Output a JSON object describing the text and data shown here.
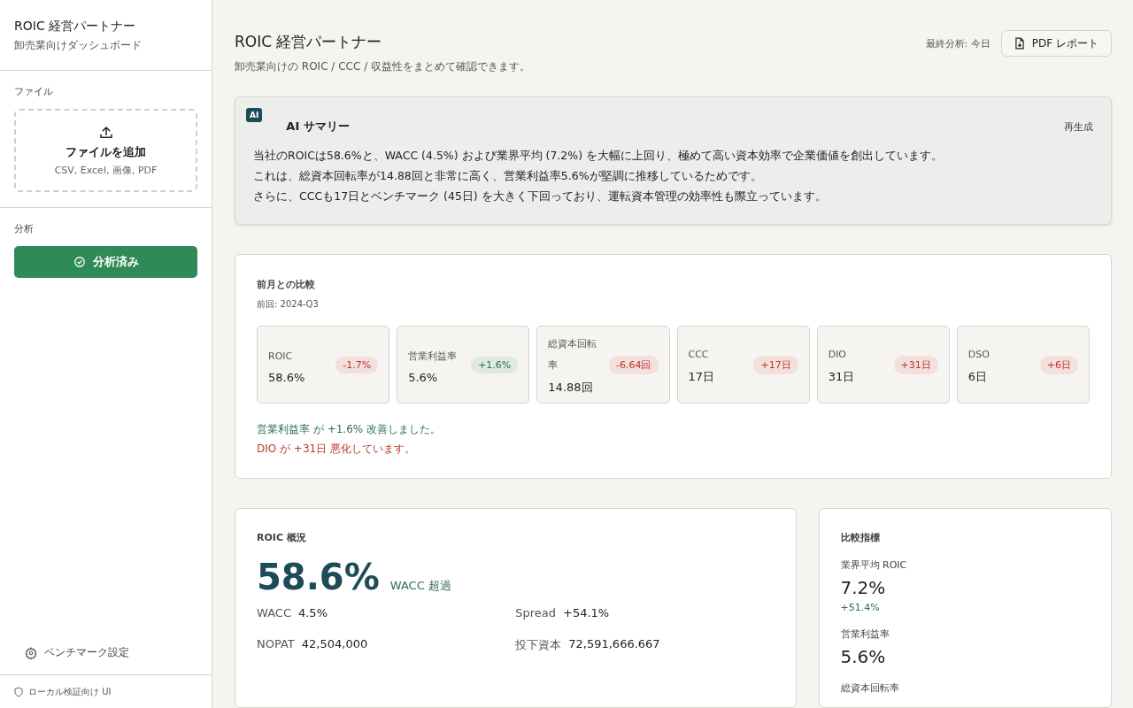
{
  "sidebar": {
    "app_title": "ROIC 経営パートナー",
    "app_subtitle": "卸売業向けダッシュボード",
    "file_section": {
      "heading": "ファイル",
      "upload_label": "ファイルを追加",
      "upload_hint": "CSV, Excel, 画像, PDF"
    },
    "analysis_section": {
      "heading": "分析",
      "button_label": "分析済み",
      "done": true
    },
    "settings_link": "ベンチマーク設定",
    "footer_note": "ローカル検証向け UI"
  },
  "header": {
    "title": "ROIC 経営パートナー",
    "subtitle": "卸売業向けの ROIC / CCC / 収益性をまとめて確認できます。",
    "last_analysis": "最終分析: 今日",
    "pdf_button": "PDF レポート"
  },
  "ai_summary": {
    "badge": "AI",
    "title": "AI サマリー",
    "regenerate": "再生成",
    "lines": [
      "当社のROICは58.6%と、WACC (4.5%) および業界平均 (7.2%) を大幅に上回り、極めて高い資本効率で企業価値を創出しています。",
      "これは、総資本回転率が14.88回と非常に高く、営業利益率5.6%が堅調に推移しているためです。",
      "さらに、CCCも17日とベンチマーク (45日) を大きく下回っており、運転資本管理の効率性も際立っています。"
    ]
  },
  "comparison": {
    "title": "前月との比較",
    "previous": "前回: 2024-Q3",
    "metrics": [
      {
        "label": "ROIC",
        "value": "58.6%",
        "delta": "-1.7%",
        "kind": "bad"
      },
      {
        "label": "営業利益率",
        "value": "5.6%",
        "delta": "+1.6%",
        "kind": "good"
      },
      {
        "label": "総資本回転率",
        "value": "14.88回",
        "delta": "-6.64回",
        "kind": "bad"
      },
      {
        "label": "CCC",
        "value": "17日",
        "delta": "+17日",
        "kind": "bad"
      },
      {
        "label": "DIO",
        "value": "31日",
        "delta": "+31日",
        "kind": "bad"
      },
      {
        "label": "DSO",
        "value": "6日",
        "delta": "+6日",
        "kind": "bad"
      }
    ],
    "notes": [
      {
        "text": "営業利益率 が +1.6% 改善しました。",
        "kind": "good"
      },
      {
        "text": "DIO が +31日 悪化しています。",
        "kind": "bad"
      }
    ]
  },
  "roic_overview": {
    "title": "ROIC 概況",
    "value": "58.6%",
    "status": "WACC 超過",
    "stats": [
      {
        "label": "WACC",
        "value": "4.5%"
      },
      {
        "label": "Spread",
        "value": "+54.1%"
      },
      {
        "label": "NOPAT",
        "value": "42,504,000"
      },
      {
        "label": "投下資本",
        "value": "72,591,666.667"
      }
    ]
  },
  "benchmarks": {
    "title": "比較指標",
    "items": [
      {
        "label": "業界平均 ROIC",
        "value": "7.2%",
        "diff": "+51.4%"
      },
      {
        "label": "営業利益率",
        "value": "5.6%"
      },
      {
        "label": "総資本回転率"
      }
    ]
  }
}
